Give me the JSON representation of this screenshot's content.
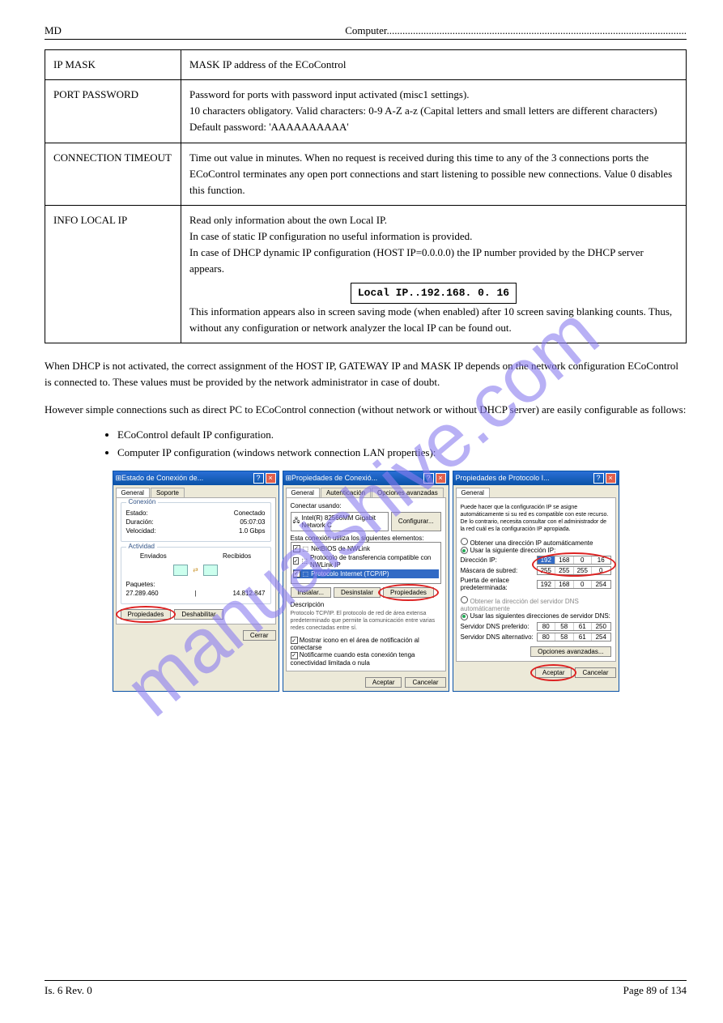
{
  "header": {
    "left": "MD",
    "right": "Computer.................................................................................................................."
  },
  "table": {
    "rows": [
      {
        "k": "IP MASK",
        "v": "MASK IP address of the ECoControl"
      },
      {
        "k": "PORT PASSWORD",
        "v": "Password for ports with password input activated (misc1 settings).\n10 characters obligatory. Valid characters: 0-9 A-Z a-z (Capital letters and small letters are different characters) Default password: 'AAAAAAAAAA'"
      },
      {
        "k": "CONNECTION TIMEOUT",
        "v": "Time out value in minutes. When no request is received during this time to any of the 3 connections ports the ECoControl terminates any open port connections and start listening to possible new connections. Value 0 disables this function."
      },
      {
        "k": "INFO LOCAL IP",
        "v": "Read only information about the own Local IP.\nIn case of static IP configuration no useful information is provided.\nIn case of DHCP dynamic IP configuration (HOST IP=0.0.0.0) the IP number provided by the DHCP server appears.\n[IPBOX]\nThis information appears also in screen saving mode (when enabled) after 10 screen saving blanking counts. Thus, without any configuration or network analyzer the local IP can be found out."
      }
    ],
    "ipbox": "Local IP..192.168.  0.  16"
  },
  "paragraphs": [
    "When DHCP is not activated, the correct assignment of the HOST IP, GATEWAY IP and MASK IP depends on the network configuration ECoControl is connected to. These values must be provided by the network administrator in case of doubt.",
    "However simple connections such as direct PC to ECoControl connection (without network or without DHCP server) are easily configurable as follows:"
  ],
  "bullets": [
    "ECoControl default IP configuration.",
    "Computer IP configuration (windows network connection LAN properties):"
  ],
  "dialogs": {
    "d1": {
      "title": "Estado de Conexión de...",
      "tabs": [
        "General",
        "Soporte"
      ],
      "group1": {
        "legend": "Conexión",
        "rows": [
          [
            "Estado:",
            "Conectado"
          ],
          [
            "Duración:",
            "05:07:03"
          ],
          [
            "Velocidad:",
            "1.0 Gbps"
          ]
        ]
      },
      "group2": {
        "legend": "Actividad",
        "labels": [
          "Enviados",
          "Recibidos"
        ],
        "pkt_label": "Paquetes:",
        "pkt_vals": [
          "27.289.460",
          "14.812.847"
        ]
      },
      "btn_props": "Propiedades",
      "btn_dis": "Deshabilitar",
      "btn_close": "Cerrar"
    },
    "d2": {
      "title": "Propiedades de Conexió...",
      "tabs": [
        "General",
        "Autenticación",
        "Opciones avanzadas"
      ],
      "connect_label": "Conectar usando:",
      "adapter": "Intel(R) 82566MM Gigabit Network C",
      "btn_conf": "Configurar...",
      "uses_label": "Esta conexión utiliza los siguientes elementos:",
      "items": [
        "NetBIOS de NWLink",
        "Protocolo de transferencia compatible con NWLink IP",
        "Protocolo Internet (TCP/IP)"
      ],
      "btn_install": "Instalar...",
      "btn_uninstall": "Desinstalar",
      "btn_props": "Propiedades",
      "desc_label": "Descripción",
      "desc": "Protocolo TCP/IP. El protocolo de red de área extensa predeterminado que permite la comunicación entre varias redes conectadas entre sí.",
      "chk1": "Mostrar icono en el área de notificación al conectarse",
      "chk2": "Notificarme cuando esta conexión tenga conectividad limitada o nula",
      "btn_ok": "Aceptar",
      "btn_cancel": "Cancelar"
    },
    "d3": {
      "title": "Propiedades de Protocolo I...",
      "tabs": [
        "General"
      ],
      "intro": "Puede hacer que la configuración IP se asigne automáticamente si su red es compatible con este recurso. De lo contrario, necesita consultar con el administrador de la red cuál es la configuración IP apropiada.",
      "opt_auto": "Obtener una dirección IP automáticamente",
      "opt_static": "Usar la siguiente dirección IP:",
      "ip_label": "Dirección IP:",
      "ip": [
        "192",
        "168",
        "0",
        "16"
      ],
      "mask_label": "Máscara de subred:",
      "mask": [
        "255",
        "255",
        "255",
        "0"
      ],
      "gw_label": "Puerta de enlace predeterminada:",
      "gw": [
        "192",
        "168",
        "0",
        "254"
      ],
      "dns_auto": "Obtener la dirección del servidor DNS automáticamente",
      "dns_static": "Usar las siguientes direcciones de servidor DNS:",
      "dns1_label": "Servidor DNS preferido:",
      "dns1": [
        "80",
        "58",
        "61",
        "250"
      ],
      "dns2_label": "Servidor DNS alternativo:",
      "dns2": [
        "80",
        "58",
        "61",
        "254"
      ],
      "btn_adv": "Opciones avanzadas...",
      "btn_ok": "Aceptar",
      "btn_cancel": "Cancelar"
    }
  },
  "footer": {
    "left": "Is. 6    Rev. 0",
    "right": "Page 89 of 134"
  },
  "watermark": "manualshive.com"
}
